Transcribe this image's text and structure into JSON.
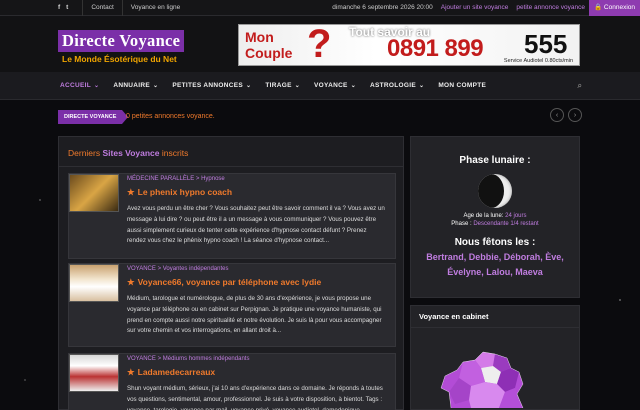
{
  "topbar": {
    "facebook_icon": "f",
    "twitter_icon": "t",
    "contact": "Contact",
    "online": "Voyance en ligne",
    "date": "dimanche 6 septembre 2026 20:00",
    "add_site": "Ajouter un site voyance",
    "small_ad": "petite annonce voyance",
    "login": "Connexion"
  },
  "logo": {
    "title": "Directe Voyance",
    "subtitle": "Le Monde Ésotérique du Net"
  },
  "banner": {
    "mon": "Mon",
    "couple": "Couple",
    "qmark": "?",
    "tagline": "Tout savoir au",
    "number": "0891 899",
    "short": "555",
    "audiotel": "Service Audiotel 0.80cts/min"
  },
  "nav": {
    "items": [
      "ACCUEIL",
      "ANNUAIRE",
      "PETITES ANNONCES",
      "TIRAGE",
      "VOYANCE",
      "ASTROLOGIE",
      "MON COMPTE"
    ]
  },
  "ticker": {
    "tag_prefix": "DIRECTE",
    "tag_word": "VOYANCE",
    "text": "0 petites annonces voyance."
  },
  "main": {
    "title_pre": "Derniers",
    "title_word": "Sites Voyance",
    "title_post": "inscrits",
    "cards": [
      {
        "category": "MÉDECINE PARALLÈLE > Hypnose",
        "title": "Le phenix hypno coach",
        "desc": "Avez vous perdu un être cher ? Vous souhaitez peut être savoir comment il va ? Vous avez un message à lui dire ? ou peut être il a un message à vous communiquer ? Vous pouvez être aussi simplement curieux de tenter cette expérience d'hypnose contact défunt ? Prenez rendez vous chez le phénix hypno coach ! La séance d'hypnose contact..."
      },
      {
        "category": "VOYANCE > Voyantes indépendantes",
        "title": "Voyance66, voyance par téléphone avec lydie",
        "desc": "Médium, tarologue et numérologue, de plus de 30 ans d'expérience, je vous propose une voyance par téléphone ou en cabinet sur Perpignan. Je pratique une voyance humaniste, qui prend en compte aussi notre spiritualité et notre évolution. Je suis là pour vous accompagner sur votre chemin et vos interrogations, en allant droit à..."
      },
      {
        "category": "VOYANCE > Médiums hommes indépendants",
        "title": "Ladamedecarreaux",
        "desc": "Shun voyant médium, sérieux, j'ai 10 ans d'expérience dans ce domaine. Je réponds à toutes vos questions, sentimental, amour, professionnel. Je suis à votre disposition, à bientot. Tags : voyance, tarologie, voyance par mail, voyance privé, voyance audiotel, damedepique..."
      }
    ]
  },
  "moon": {
    "title": "Phase lunaire :",
    "age_label": "Age de la lune:",
    "age_value": "24 jours",
    "phase_label": "Phase :",
    "phase_value": "Descendante 1/4 restant"
  },
  "feast": {
    "title": "Nous fêtons les :",
    "names": "Bertrand, Debbie, Déborah, Ève, Évelyne, Lalou, Maeva"
  },
  "cabinet": {
    "title": "Voyance en cabinet"
  },
  "colors": {
    "accent": "#7b2fa8",
    "orange": "#f07a2c",
    "lilac": "#c07de0"
  }
}
